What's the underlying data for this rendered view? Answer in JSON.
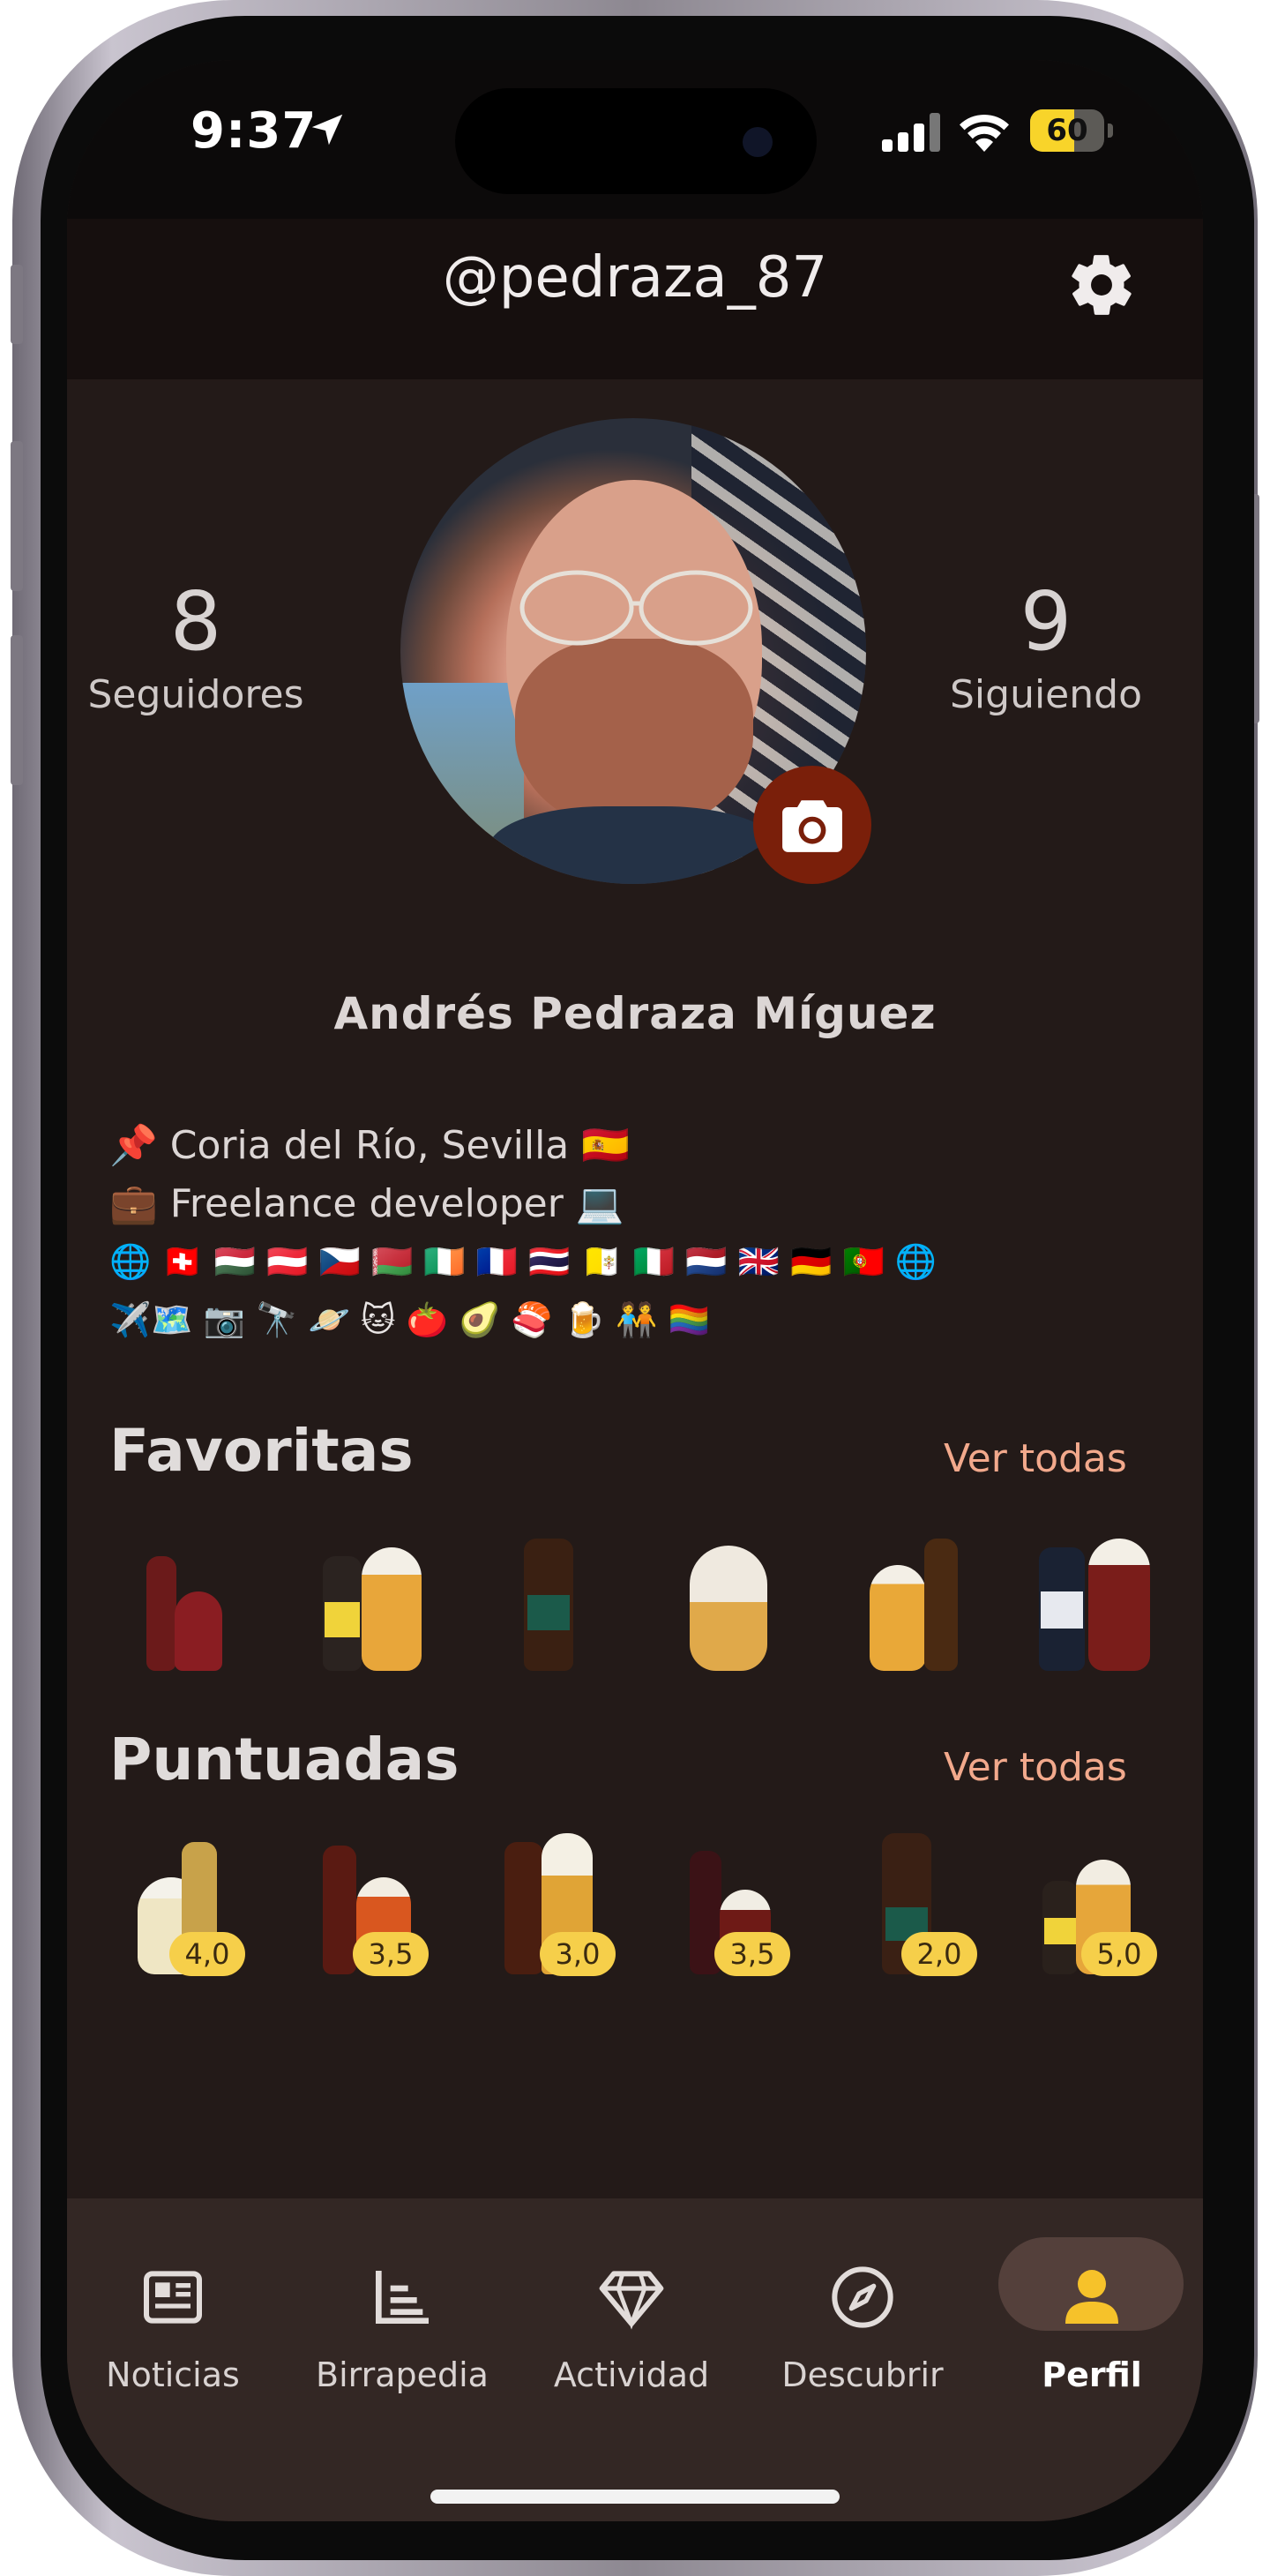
{
  "status_bar": {
    "time": "9:37",
    "battery_level": "60",
    "battery_fraction": 0.6
  },
  "header": {
    "username": "@pedraza_87"
  },
  "profile": {
    "followers_count": "8",
    "followers_label": "Seguidores",
    "following_count": "9",
    "following_label": "Siguiendo",
    "full_name": "Andrés Pedraza Míguez",
    "bio": {
      "location": "📌 Coria del Río, Sevilla 🇪🇸",
      "job": "💼 Freelance developer 💻",
      "flags": "🌐 🇨🇭 🇭🇺 🇦🇹 🇨🇿 🇧🇾 🇮🇪 🇫🇷 🇹🇭 🇻🇦 🇮🇹 🇳🇱 🇬🇧 🇩🇪 🇵🇹 🌐",
      "hobbies": "✈️🗺️ 📷 🔭 🪐 🐱 🍅 🥑 🍣 🍺 🧑‍🤝‍🧑 🏳️‍🌈"
    }
  },
  "favorites": {
    "title": "Favoritas",
    "see_all": "Ver todas"
  },
  "rated": {
    "title": "Puntuadas",
    "see_all": "Ver todas",
    "ratings": [
      "4,0",
      "3,5",
      "3,0",
      "3,5",
      "2,0",
      "5,0"
    ]
  },
  "tab_bar": {
    "tabs": [
      {
        "label": "Noticias",
        "icon": "newspaper-icon"
      },
      {
        "label": "Birrapedia",
        "icon": "list-icon"
      },
      {
        "label": "Actividad",
        "icon": "diamond-icon"
      },
      {
        "label": "Descubrir",
        "icon": "compass-icon"
      },
      {
        "label": "Perfil",
        "icon": "person-icon"
      }
    ],
    "active_tab": "Perfil"
  },
  "colors": {
    "background": "#231a18",
    "accent": "#f2a98c",
    "active_tab_icon": "#f6c22a",
    "camera_button": "#7a1f0a",
    "rating_badge": "#f6cf4a"
  }
}
